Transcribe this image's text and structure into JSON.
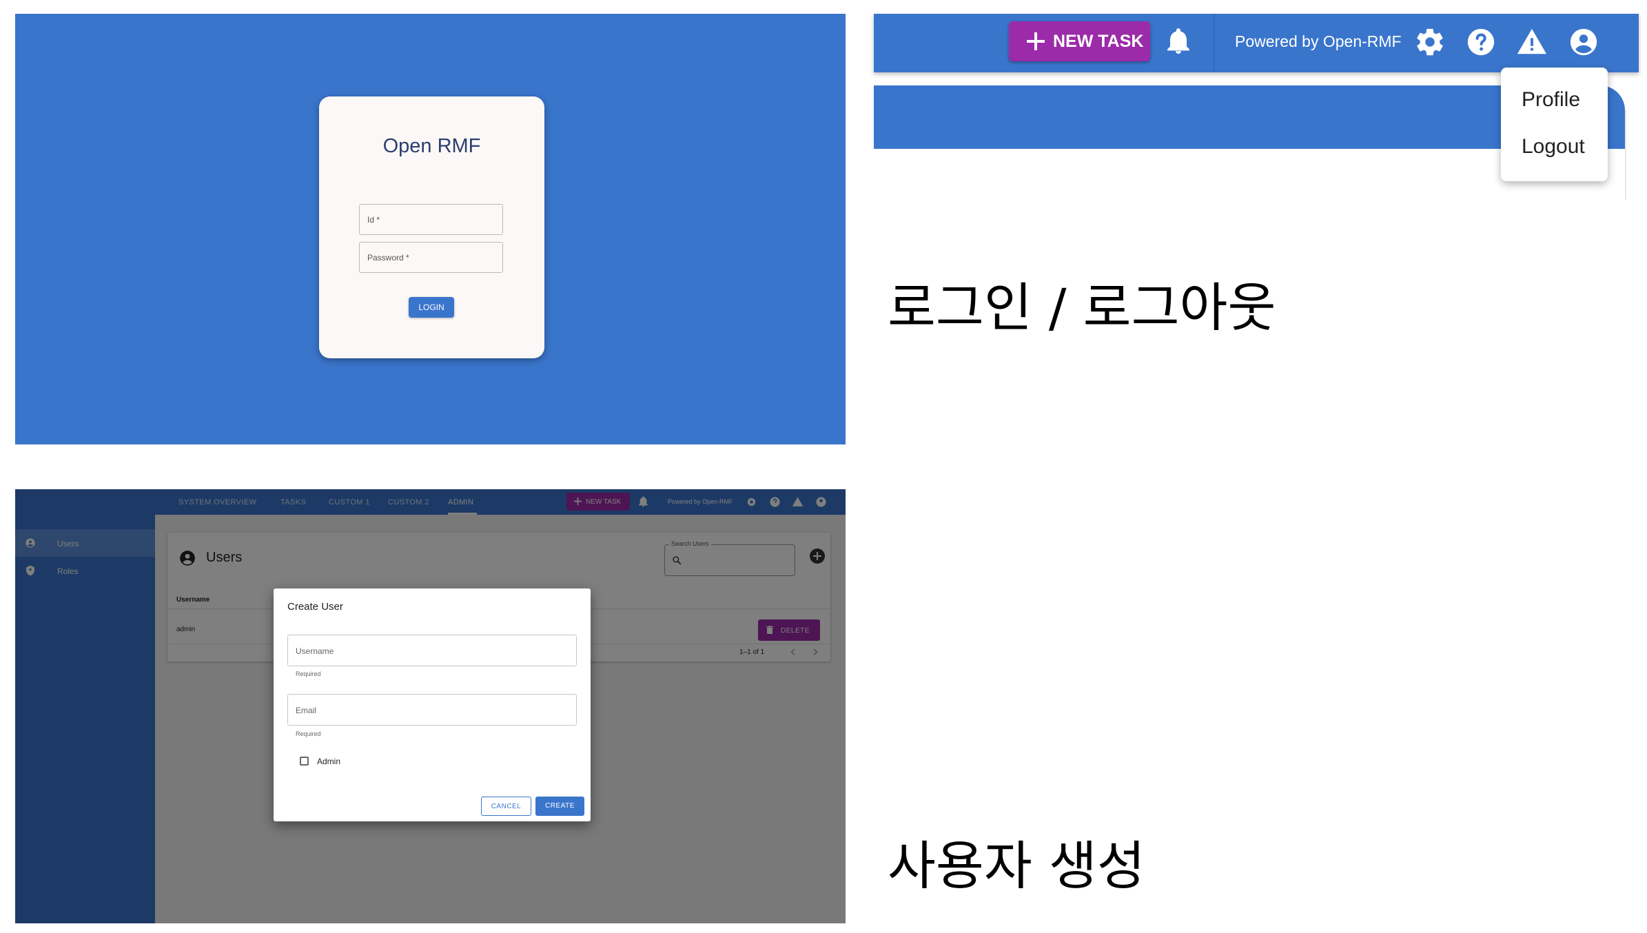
{
  "login": {
    "title": "Open RMF",
    "id_label": "Id *",
    "password_label": "Password *",
    "login_button": "LOGIN"
  },
  "header": {
    "new_task": "NEW TASK",
    "powered_by": "Powered by Open-RMF",
    "menu": {
      "profile": "Profile",
      "logout": "Logout"
    },
    "icons": [
      "add-icon",
      "bell-icon",
      "gear-icon",
      "help-icon",
      "warning-icon",
      "account-circle-icon"
    ]
  },
  "captions": {
    "login_logout": "로그인 / 로그아웃",
    "user_creation": "사용자 생성"
  },
  "admin": {
    "tabs": [
      "SYSTEM OVERVIEW",
      "TASKS",
      "CUSTOM 1",
      "CUSTOM 2",
      "ADMIN"
    ],
    "active_tab": "ADMIN",
    "new_task": "NEW TASK",
    "powered_by": "Powered by Open-RMF",
    "drawer": [
      "Users",
      "Roles"
    ],
    "users_title": "Users",
    "search_label": "Search Users",
    "column_username": "Username",
    "rows": [
      {
        "username": "admin",
        "action": "DELETE"
      }
    ],
    "pagination": "1–1 of 1"
  },
  "dialog": {
    "title": "Create User",
    "username_placeholder": "Username",
    "username_helper": "Required",
    "email_placeholder": "Email",
    "email_helper": "Required",
    "admin_checkbox": "Admin",
    "admin_checked": false,
    "cancel": "CANCEL",
    "create": "CREATE"
  },
  "colors": {
    "primary_blue": "#3a75cc",
    "purple": "#9b2ba8",
    "card": "#fcf8f7"
  }
}
